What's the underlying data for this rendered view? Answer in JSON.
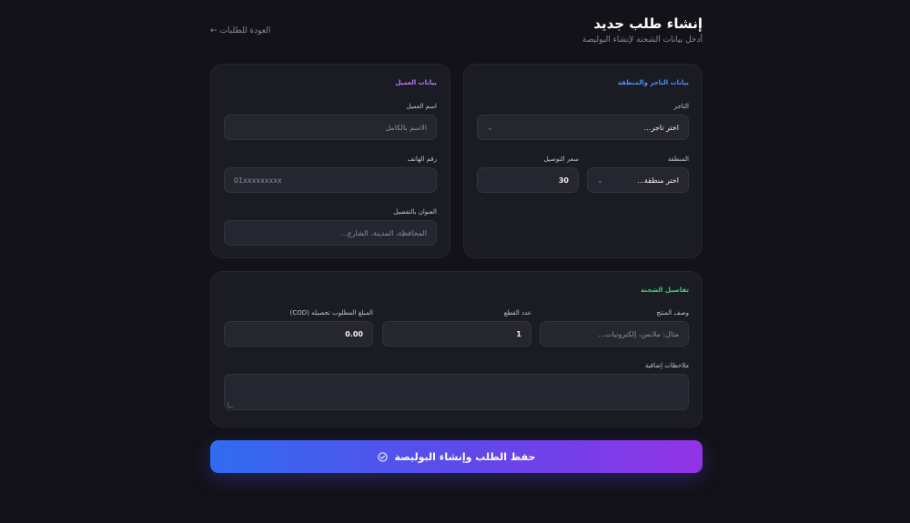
{
  "header": {
    "title": "إنشاء طلب جديد",
    "subtitle": "أدخل بيانات الشحنة لإنشاء البوليصة",
    "back_label": "العودة للطلبات",
    "back_arrow": "←"
  },
  "merchant_card": {
    "title": "بيانات التاجر والمنطقة",
    "title_color": "#4f8ff7",
    "merchant_label": "التاجر",
    "merchant_value": "اختر تاجر...",
    "region_label": "المنطقة",
    "region_value": "اختر منطقة...",
    "delivery_price_label": "سعر التوصيل",
    "delivery_price_value": "30"
  },
  "customer_card": {
    "title": "بيانات العميل",
    "title_color": "#b77bf5",
    "name_label": "اسم العميل",
    "name_placeholder": "الاسم بالكامل",
    "phone_label": "رقم الهاتف",
    "phone_placeholder": "01xxxxxxxxx",
    "address_label": "العنوان بالتفصيل",
    "address_placeholder": "المحافظة، المدينة، الشارع..."
  },
  "shipment_card": {
    "title": "تفاصيل الشحنة",
    "title_color": "#3fd07a",
    "product_label": "وصف المنتج",
    "product_placeholder": "مثال: ملابس، إلكترونيات...",
    "pieces_label": "عدد القطع",
    "pieces_value": "1",
    "cod_label": "المبلغ المطلوب تحصيله (COD)",
    "cod_value": "0.00",
    "notes_label": "ملاحظات إضافية"
  },
  "submit": {
    "label": "حفظ الطلب وإنشاء البوليصة",
    "icon": "check-circle-icon"
  }
}
